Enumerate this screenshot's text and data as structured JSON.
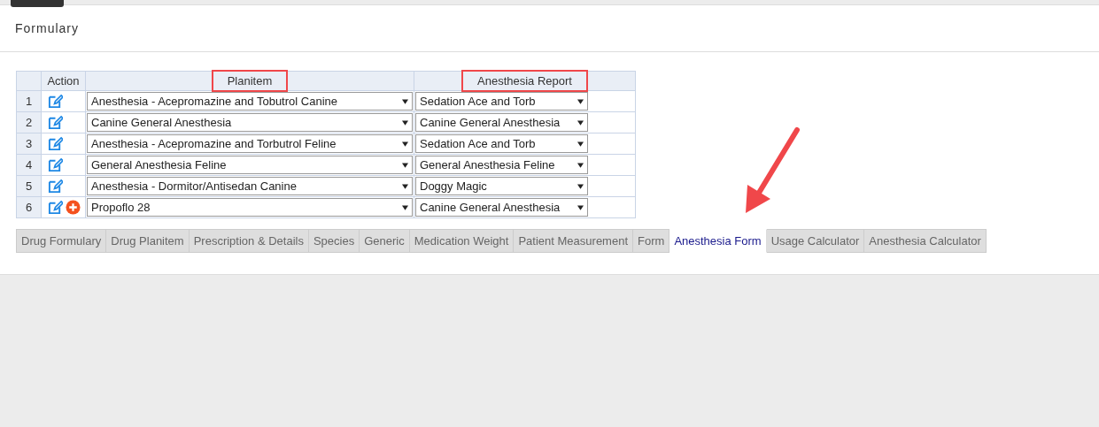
{
  "page": {
    "title": "Formulary"
  },
  "table": {
    "columns": [
      {
        "label": "Action",
        "highlighted": false
      },
      {
        "label": "Planitem",
        "highlighted": true
      },
      {
        "label": "Anesthesia Report",
        "highlighted": true
      }
    ],
    "rows": [
      {
        "number": "1",
        "planitem": "Anesthesia - Acepromazine and Tobutrol Canine",
        "report": "Sedation Ace and Torb",
        "can_add": false
      },
      {
        "number": "2",
        "planitem": "Canine General Anesthesia",
        "report": "Canine General Anesthesia",
        "can_add": false
      },
      {
        "number": "3",
        "planitem": "Anesthesia - Acepromazine and Torbutrol Feline",
        "report": "Sedation Ace and Torb",
        "can_add": false
      },
      {
        "number": "4",
        "planitem": "General Anesthesia Feline",
        "report": "General Anesthesia Feline",
        "can_add": false
      },
      {
        "number": "5",
        "planitem": "Anesthesia - Dormitor/Antisedan Canine",
        "report": "Doggy Magic",
        "can_add": false
      },
      {
        "number": "6",
        "planitem": "Propoflo 28",
        "report": "Canine General Anesthesia",
        "can_add": true
      }
    ]
  },
  "tabs": [
    {
      "label": "Drug Formulary",
      "selected": false
    },
    {
      "label": "Drug Planitem",
      "selected": false
    },
    {
      "label": "Prescription & Details",
      "selected": false
    },
    {
      "label": "Species",
      "selected": false
    },
    {
      "label": "Generic",
      "selected": false
    },
    {
      "label": "Medication Weight",
      "selected": false
    },
    {
      "label": "Patient Measurement",
      "selected": false
    },
    {
      "label": "Form",
      "selected": false
    },
    {
      "label": "Anesthesia Form",
      "selected": true
    },
    {
      "label": "Usage Calculator",
      "selected": false
    },
    {
      "label": "Anesthesia Calculator",
      "selected": false
    }
  ],
  "annotation_arrow": true
}
